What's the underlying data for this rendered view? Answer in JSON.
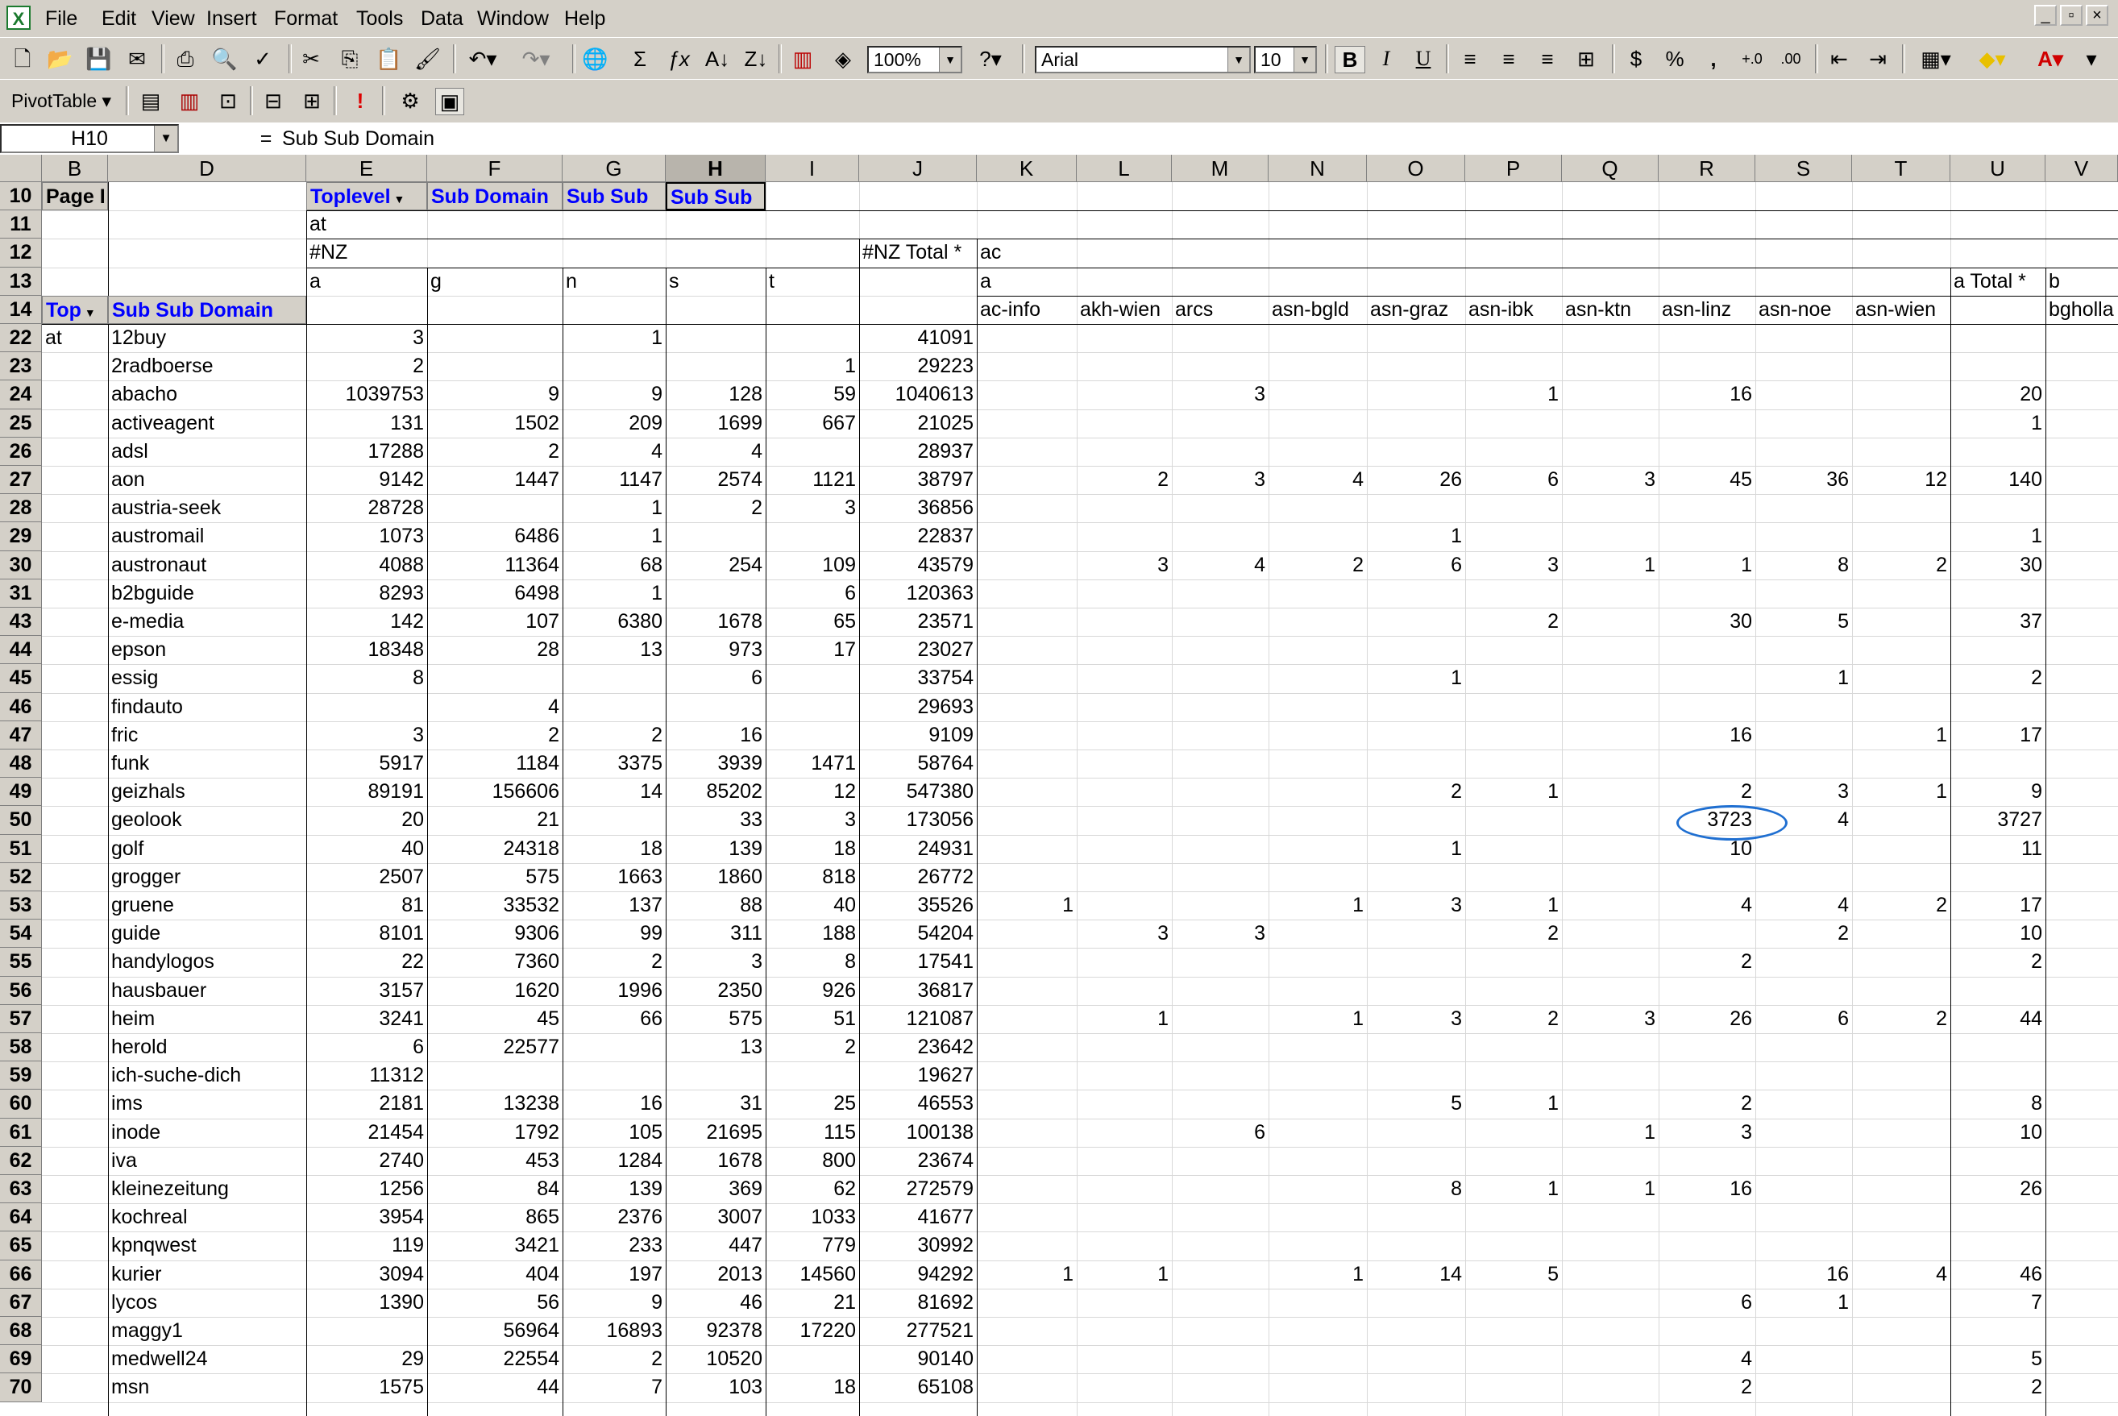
{
  "menu": [
    "File",
    "Edit",
    "View",
    "Insert",
    "Format",
    "Tools",
    "Data",
    "Window",
    "Help"
  ],
  "toolbar": {
    "zoom": "100%",
    "font": "Arial",
    "font_size": "10",
    "pivot_label": "PivotTable ▾"
  },
  "formula": {
    "namebox": "H10",
    "eq": "=",
    "content": "Sub Sub Domain"
  },
  "columns": [
    "B",
    "D",
    "E",
    "F",
    "G",
    "H",
    "I",
    "J",
    "K",
    "L",
    "M",
    "N",
    "O",
    "P",
    "Q",
    "R",
    "S",
    "T",
    "U",
    "V"
  ],
  "header_rows": {
    "r10": {
      "row": "10",
      "b": "Page I",
      "e": "Toplevel",
      "f": "Sub Domain",
      "g": "Sub Sub",
      "h": "Sub Sub"
    },
    "r11": {
      "row": "11",
      "e": "at"
    },
    "r12": {
      "row": "12",
      "e": "#NZ",
      "j": "#NZ Total *",
      "k": "ac"
    },
    "r13": {
      "row": "13",
      "e": "a",
      "f": "g",
      "g": "n",
      "h": "s",
      "i": "t",
      "k": "a",
      "u": "a Total *",
      "v": "b"
    },
    "r14": {
      "row": "14",
      "b": "Top",
      "d": "Sub Sub Domain",
      "k": "ac-info",
      "l": "akh-wien",
      "m": "arcs",
      "n": "asn-bgld",
      "o": "asn-graz",
      "p": "asn-ibk",
      "q": "asn-ktn",
      "r": "asn-linz",
      "s": "asn-noe",
      "t": "asn-wien",
      "v": "bgholla"
    }
  },
  "rows": [
    {
      "row": "22",
      "b": "at",
      "d": "12buy",
      "e": "3",
      "f": "",
      "g": "1",
      "h": "",
      "i": "",
      "j": "41091",
      "k": "",
      "l": "",
      "m": "",
      "n": "",
      "o": "",
      "p": "",
      "q": "",
      "r": "",
      "s": "",
      "t": "",
      "u": ""
    },
    {
      "row": "23",
      "b": "",
      "d": "2radboerse",
      "e": "2",
      "f": "",
      "g": "",
      "h": "",
      "i": "1",
      "j": "29223",
      "k": "",
      "l": "",
      "m": "",
      "n": "",
      "o": "",
      "p": "",
      "q": "",
      "r": "",
      "s": "",
      "t": "",
      "u": ""
    },
    {
      "row": "24",
      "b": "",
      "d": "abacho",
      "e": "1039753",
      "f": "9",
      "g": "9",
      "h": "128",
      "i": "59",
      "j": "1040613",
      "k": "",
      "l": "",
      "m": "3",
      "n": "",
      "o": "",
      "p": "1",
      "q": "",
      "r": "16",
      "s": "",
      "t": "",
      "u": "20"
    },
    {
      "row": "25",
      "b": "",
      "d": "activeagent",
      "e": "131",
      "f": "1502",
      "g": "209",
      "h": "1699",
      "i": "667",
      "j": "21025",
      "k": "",
      "l": "",
      "m": "",
      "n": "",
      "o": "",
      "p": "",
      "q": "",
      "r": "",
      "s": "",
      "t": "",
      "u": "1"
    },
    {
      "row": "26",
      "b": "",
      "d": "adsl",
      "e": "17288",
      "f": "2",
      "g": "4",
      "h": "4",
      "i": "",
      "j": "28937",
      "k": "",
      "l": "",
      "m": "",
      "n": "",
      "o": "",
      "p": "",
      "q": "",
      "r": "",
      "s": "",
      "t": "",
      "u": ""
    },
    {
      "row": "27",
      "b": "",
      "d": "aon",
      "e": "9142",
      "f": "1447",
      "g": "1147",
      "h": "2574",
      "i": "1121",
      "j": "38797",
      "k": "",
      "l": "2",
      "m": "3",
      "n": "4",
      "o": "26",
      "p": "6",
      "q": "3",
      "r": "45",
      "s": "36",
      "t": "12",
      "u": "140"
    },
    {
      "row": "28",
      "b": "",
      "d": "austria-seek",
      "e": "28728",
      "f": "",
      "g": "1",
      "h": "2",
      "i": "3",
      "j": "36856",
      "k": "",
      "l": "",
      "m": "",
      "n": "",
      "o": "",
      "p": "",
      "q": "",
      "r": "",
      "s": "",
      "t": "",
      "u": ""
    },
    {
      "row": "29",
      "b": "",
      "d": "austromail",
      "e": "1073",
      "f": "6486",
      "g": "1",
      "h": "",
      "i": "",
      "j": "22837",
      "k": "",
      "l": "",
      "m": "",
      "n": "",
      "o": "1",
      "p": "",
      "q": "",
      "r": "",
      "s": "",
      "t": "",
      "u": "1"
    },
    {
      "row": "30",
      "b": "",
      "d": "austronaut",
      "e": "4088",
      "f": "11364",
      "g": "68",
      "h": "254",
      "i": "109",
      "j": "43579",
      "k": "",
      "l": "3",
      "m": "4",
      "n": "2",
      "o": "6",
      "p": "3",
      "q": "1",
      "r": "1",
      "s": "8",
      "t": "2",
      "u": "30"
    },
    {
      "row": "31",
      "b": "",
      "d": "b2bguide",
      "e": "8293",
      "f": "6498",
      "g": "1",
      "h": "",
      "i": "6",
      "j": "120363",
      "k": "",
      "l": "",
      "m": "",
      "n": "",
      "o": "",
      "p": "",
      "q": "",
      "r": "",
      "s": "",
      "t": "",
      "u": ""
    },
    {
      "row": "43",
      "b": "",
      "d": "e-media",
      "e": "142",
      "f": "107",
      "g": "6380",
      "h": "1678",
      "i": "65",
      "j": "23571",
      "k": "",
      "l": "",
      "m": "",
      "n": "",
      "o": "",
      "p": "2",
      "q": "",
      "r": "30",
      "s": "5",
      "t": "",
      "u": "37"
    },
    {
      "row": "44",
      "b": "",
      "d": "epson",
      "e": "18348",
      "f": "28",
      "g": "13",
      "h": "973",
      "i": "17",
      "j": "23027",
      "k": "",
      "l": "",
      "m": "",
      "n": "",
      "o": "",
      "p": "",
      "q": "",
      "r": "",
      "s": "",
      "t": "",
      "u": ""
    },
    {
      "row": "45",
      "b": "",
      "d": "essig",
      "e": "8",
      "f": "",
      "g": "",
      "h": "6",
      "i": "",
      "j": "33754",
      "k": "",
      "l": "",
      "m": "",
      "n": "",
      "o": "1",
      "p": "",
      "q": "",
      "r": "",
      "s": "1",
      "t": "",
      "u": "2"
    },
    {
      "row": "46",
      "b": "",
      "d": "findauto",
      "e": "",
      "f": "4",
      "g": "",
      "h": "",
      "i": "",
      "j": "29693",
      "k": "",
      "l": "",
      "m": "",
      "n": "",
      "o": "",
      "p": "",
      "q": "",
      "r": "",
      "s": "",
      "t": "",
      "u": ""
    },
    {
      "row": "47",
      "b": "",
      "d": "fric",
      "e": "3",
      "f": "2",
      "g": "2",
      "h": "16",
      "i": "",
      "j": "9109",
      "k": "",
      "l": "",
      "m": "",
      "n": "",
      "o": "",
      "p": "",
      "q": "",
      "r": "16",
      "s": "",
      "t": "1",
      "u": "17"
    },
    {
      "row": "48",
      "b": "",
      "d": "funk",
      "e": "5917",
      "f": "1184",
      "g": "3375",
      "h": "3939",
      "i": "1471",
      "j": "58764",
      "k": "",
      "l": "",
      "m": "",
      "n": "",
      "o": "",
      "p": "",
      "q": "",
      "r": "",
      "s": "",
      "t": "",
      "u": ""
    },
    {
      "row": "49",
      "b": "",
      "d": "geizhals",
      "e": "89191",
      "f": "156606",
      "g": "14",
      "h": "85202",
      "i": "12",
      "j": "547380",
      "k": "",
      "l": "",
      "m": "",
      "n": "",
      "o": "2",
      "p": "1",
      "q": "",
      "r": "2",
      "s": "3",
      "t": "1",
      "u": "9"
    },
    {
      "row": "50",
      "b": "",
      "d": "geolook",
      "e": "20",
      "f": "21",
      "g": "",
      "h": "33",
      "i": "3",
      "j": "173056",
      "k": "",
      "l": "",
      "m": "",
      "n": "",
      "o": "",
      "p": "",
      "q": "",
      "r": "3723",
      "s": "4",
      "t": "",
      "u": "3727"
    },
    {
      "row": "51",
      "b": "",
      "d": "golf",
      "e": "40",
      "f": "24318",
      "g": "18",
      "h": "139",
      "i": "18",
      "j": "24931",
      "k": "",
      "l": "",
      "m": "",
      "n": "",
      "o": "1",
      "p": "",
      "q": "",
      "r": "10",
      "s": "",
      "t": "",
      "u": "11"
    },
    {
      "row": "52",
      "b": "",
      "d": "grogger",
      "e": "2507",
      "f": "575",
      "g": "1663",
      "h": "1860",
      "i": "818",
      "j": "26772",
      "k": "",
      "l": "",
      "m": "",
      "n": "",
      "o": "",
      "p": "",
      "q": "",
      "r": "",
      "s": "",
      "t": "",
      "u": ""
    },
    {
      "row": "53",
      "b": "",
      "d": "gruene",
      "e": "81",
      "f": "33532",
      "g": "137",
      "h": "88",
      "i": "40",
      "j": "35526",
      "k": "1",
      "l": "",
      "m": "",
      "n": "1",
      "o": "3",
      "p": "1",
      "q": "",
      "r": "4",
      "s": "4",
      "t": "2",
      "u": "17"
    },
    {
      "row": "54",
      "b": "",
      "d": "guide",
      "e": "8101",
      "f": "9306",
      "g": "99",
      "h": "311",
      "i": "188",
      "j": "54204",
      "k": "",
      "l": "3",
      "m": "3",
      "n": "",
      "o": "",
      "p": "2",
      "q": "",
      "r": "",
      "s": "2",
      "t": "",
      "u": "10"
    },
    {
      "row": "55",
      "b": "",
      "d": "handylogos",
      "e": "22",
      "f": "7360",
      "g": "2",
      "h": "3",
      "i": "8",
      "j": "17541",
      "k": "",
      "l": "",
      "m": "",
      "n": "",
      "o": "",
      "p": "",
      "q": "",
      "r": "2",
      "s": "",
      "t": "",
      "u": "2"
    },
    {
      "row": "56",
      "b": "",
      "d": "hausbauer",
      "e": "3157",
      "f": "1620",
      "g": "1996",
      "h": "2350",
      "i": "926",
      "j": "36817",
      "k": "",
      "l": "",
      "m": "",
      "n": "",
      "o": "",
      "p": "",
      "q": "",
      "r": "",
      "s": "",
      "t": "",
      "u": ""
    },
    {
      "row": "57",
      "b": "",
      "d": "heim",
      "e": "3241",
      "f": "45",
      "g": "66",
      "h": "575",
      "i": "51",
      "j": "121087",
      "k": "",
      "l": "1",
      "m": "",
      "n": "1",
      "o": "3",
      "p": "2",
      "q": "3",
      "r": "26",
      "s": "6",
      "t": "2",
      "u": "44"
    },
    {
      "row": "58",
      "b": "",
      "d": "herold",
      "e": "6",
      "f": "22577",
      "g": "",
      "h": "13",
      "i": "2",
      "j": "23642",
      "k": "",
      "l": "",
      "m": "",
      "n": "",
      "o": "",
      "p": "",
      "q": "",
      "r": "",
      "s": "",
      "t": "",
      "u": ""
    },
    {
      "row": "59",
      "b": "",
      "d": "ich-suche-dich",
      "e": "11312",
      "f": "",
      "g": "",
      "h": "",
      "i": "",
      "j": "19627",
      "k": "",
      "l": "",
      "m": "",
      "n": "",
      "o": "",
      "p": "",
      "q": "",
      "r": "",
      "s": "",
      "t": "",
      "u": ""
    },
    {
      "row": "60",
      "b": "",
      "d": "ims",
      "e": "2181",
      "f": "13238",
      "g": "16",
      "h": "31",
      "i": "25",
      "j": "46553",
      "k": "",
      "l": "",
      "m": "",
      "n": "",
      "o": "5",
      "p": "1",
      "q": "",
      "r": "2",
      "s": "",
      "t": "",
      "u": "8"
    },
    {
      "row": "61",
      "b": "",
      "d": "inode",
      "e": "21454",
      "f": "1792",
      "g": "105",
      "h": "21695",
      "i": "115",
      "j": "100138",
      "k": "",
      "l": "",
      "m": "6",
      "n": "",
      "o": "",
      "p": "",
      "q": "1",
      "r": "3",
      "s": "",
      "t": "",
      "u": "10"
    },
    {
      "row": "62",
      "b": "",
      "d": "iva",
      "e": "2740",
      "f": "453",
      "g": "1284",
      "h": "1678",
      "i": "800",
      "j": "23674",
      "k": "",
      "l": "",
      "m": "",
      "n": "",
      "o": "",
      "p": "",
      "q": "",
      "r": "",
      "s": "",
      "t": "",
      "u": ""
    },
    {
      "row": "63",
      "b": "",
      "d": "kleinezeitung",
      "e": "1256",
      "f": "84",
      "g": "139",
      "h": "369",
      "i": "62",
      "j": "272579",
      "k": "",
      "l": "",
      "m": "",
      "n": "",
      "o": "8",
      "p": "1",
      "q": "1",
      "r": "16",
      "s": "",
      "t": "",
      "u": "26"
    },
    {
      "row": "64",
      "b": "",
      "d": "kochreal",
      "e": "3954",
      "f": "865",
      "g": "2376",
      "h": "3007",
      "i": "1033",
      "j": "41677",
      "k": "",
      "l": "",
      "m": "",
      "n": "",
      "o": "",
      "p": "",
      "q": "",
      "r": "",
      "s": "",
      "t": "",
      "u": ""
    },
    {
      "row": "65",
      "b": "",
      "d": "kpnqwest",
      "e": "119",
      "f": "3421",
      "g": "233",
      "h": "447",
      "i": "779",
      "j": "30992",
      "k": "",
      "l": "",
      "m": "",
      "n": "",
      "o": "",
      "p": "",
      "q": "",
      "r": "",
      "s": "",
      "t": "",
      "u": ""
    },
    {
      "row": "66",
      "b": "",
      "d": "kurier",
      "e": "3094",
      "f": "404",
      "g": "197",
      "h": "2013",
      "i": "14560",
      "j": "94292",
      "k": "1",
      "l": "1",
      "m": "",
      "n": "1",
      "o": "14",
      "p": "5",
      "q": "",
      "r": "",
      "s": "16",
      "t": "4",
      "u": "46"
    },
    {
      "row": "67",
      "b": "",
      "d": "lycos",
      "e": "1390",
      "f": "56",
      "g": "9",
      "h": "46",
      "i": "21",
      "j": "81692",
      "k": "",
      "l": "",
      "m": "",
      "n": "",
      "o": "",
      "p": "",
      "q": "",
      "r": "6",
      "s": "1",
      "t": "",
      "u": "7"
    },
    {
      "row": "68",
      "b": "",
      "d": "maggy1",
      "e": "",
      "f": "56964",
      "g": "16893",
      "h": "92378",
      "i": "17220",
      "j": "277521",
      "k": "",
      "l": "",
      "m": "",
      "n": "",
      "o": "",
      "p": "",
      "q": "",
      "r": "",
      "s": "",
      "t": "",
      "u": ""
    },
    {
      "row": "69",
      "b": "",
      "d": "medwell24",
      "e": "29",
      "f": "22554",
      "g": "2",
      "h": "10520",
      "i": "",
      "j": "90140",
      "k": "",
      "l": "",
      "m": "",
      "n": "",
      "o": "",
      "p": "",
      "q": "",
      "r": "4",
      "s": "",
      "t": "",
      "u": "5"
    },
    {
      "row": "70",
      "b": "",
      "d": "msn",
      "e": "1575",
      "f": "44",
      "g": "7",
      "h": "103",
      "i": "18",
      "j": "65108",
      "k": "",
      "l": "",
      "m": "",
      "n": "",
      "o": "",
      "p": "",
      "q": "",
      "r": "2",
      "s": "",
      "t": "",
      "u": "2"
    }
  ]
}
